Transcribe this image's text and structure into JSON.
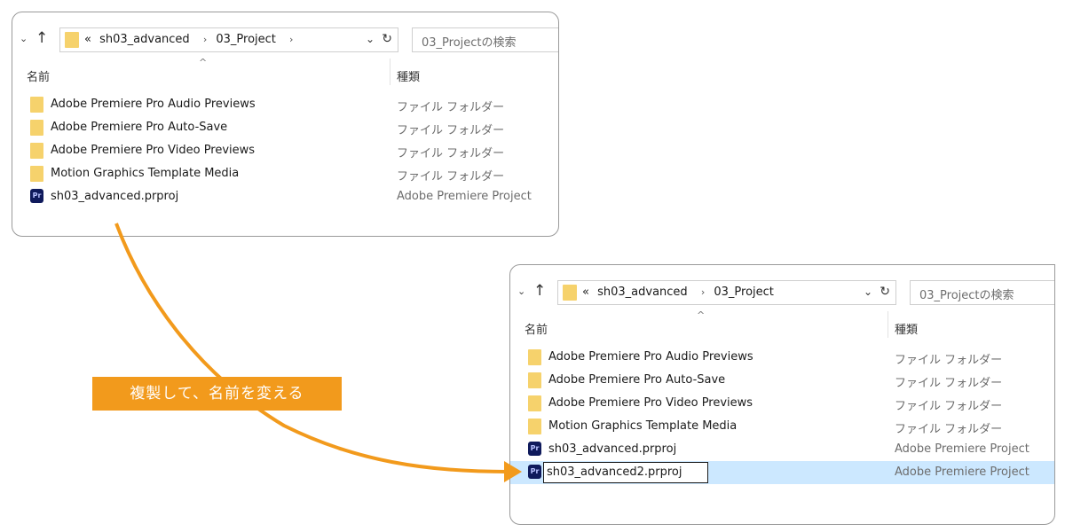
{
  "explorer_before": {
    "breadcrumb": [
      "«",
      "sh03_advanced",
      "›",
      "03_Project",
      "›"
    ],
    "search_placeholder": "03_Projectの検索",
    "column_name": "名前",
    "column_type": "種類",
    "files": [
      {
        "name": "Adobe Premiere Pro Audio Previews",
        "type": "ファイル フォルダー",
        "icon": "folder-icon"
      },
      {
        "name": "Adobe Premiere Pro Auto-Save",
        "type": "ファイル フォルダー",
        "icon": "folder-icon"
      },
      {
        "name": "Adobe Premiere Pro Video Previews",
        "type": "ファイル フォルダー",
        "icon": "folder-icon"
      },
      {
        "name": "Motion Graphics Template Media",
        "type": "ファイル フォルダー",
        "icon": "folder-icon"
      },
      {
        "name": "sh03_advanced.prproj",
        "type": "Adobe Premiere Project",
        "icon": "premiere-file-icon"
      }
    ]
  },
  "explorer_after": {
    "breadcrumb": [
      "«",
      "sh03_advanced",
      "›",
      "03_Project"
    ],
    "search_placeholder": "03_Projectの検索",
    "column_name": "名前",
    "column_type": "種類",
    "files": [
      {
        "name": "Adobe Premiere Pro Audio Previews",
        "type": "ファイル フォルダー",
        "icon": "folder-icon"
      },
      {
        "name": "Adobe Premiere Pro Auto-Save",
        "type": "ファイル フォルダー",
        "icon": "folder-icon"
      },
      {
        "name": "Adobe Premiere Pro Video Previews",
        "type": "ファイル フォルダー",
        "icon": "folder-icon"
      },
      {
        "name": "Motion Graphics Template Media",
        "type": "ファイル フォルダー",
        "icon": "folder-icon"
      },
      {
        "name": "sh03_advanced.prproj",
        "type": "Adobe Premiere Project",
        "icon": "premiere-file-icon"
      },
      {
        "name": "sh03_advanced2.prproj",
        "type": "Adobe Premiere Project",
        "icon": "premiere-file-icon",
        "renaming": true
      }
    ]
  },
  "callout": {
    "text": "複製して、名前を変える",
    "color": "#f29a1c"
  },
  "pr_icon_label": "Pr",
  "colors": {
    "accent_arrow": "#f29a1c",
    "folder": "#f6d26c",
    "selection": "#cce8ff"
  }
}
